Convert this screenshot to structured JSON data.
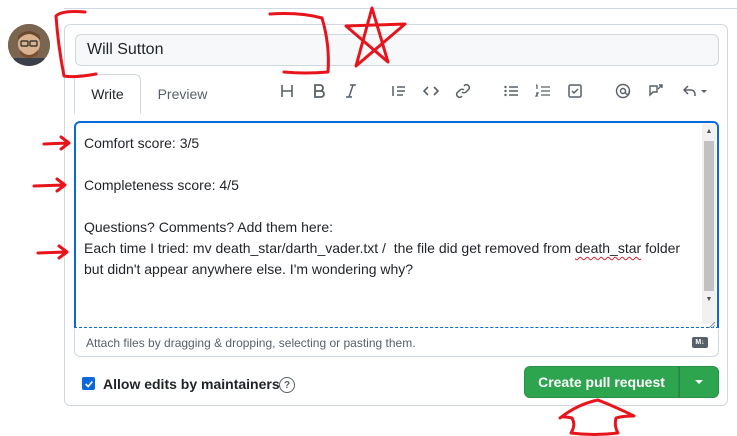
{
  "title_field": {
    "value": "Will Sutton"
  },
  "tabs": [
    {
      "label": "Write",
      "active": true
    },
    {
      "label": "Preview",
      "active": false
    }
  ],
  "toolbar": {
    "icons": [
      "heading-icon",
      "bold-icon",
      "italic-icon",
      "quote-icon",
      "code-icon",
      "link-icon",
      "bulleted-list-icon",
      "numbered-list-icon",
      "task-list-icon",
      "mention-icon",
      "cross-reference-icon",
      "reply-icon"
    ]
  },
  "editor": {
    "line1": "Comfort score: 3/5",
    "line2": "Completeness score: 4/5",
    "line3": "Questions? Comments? Add them here:",
    "line4a": "Each time I tried: mv death_star/darth_vader.txt /  the file did get removed from ",
    "line4_spell": "death_star",
    "line4b": " folder but didn't appear anywhere else. I'm wondering why?"
  },
  "attach_hint": "Attach files by dragging & dropping, selecting or pasting them.",
  "markdown_badge": "M↓",
  "allow_edits": {
    "label": "Allow edits by maintainers",
    "checked": true
  },
  "help_glyph": "?",
  "create_button": {
    "label": "Create pull request"
  },
  "colors": {
    "accent": "#0969da",
    "primary_button": "#2da44e",
    "annotation": "#e8141c"
  }
}
